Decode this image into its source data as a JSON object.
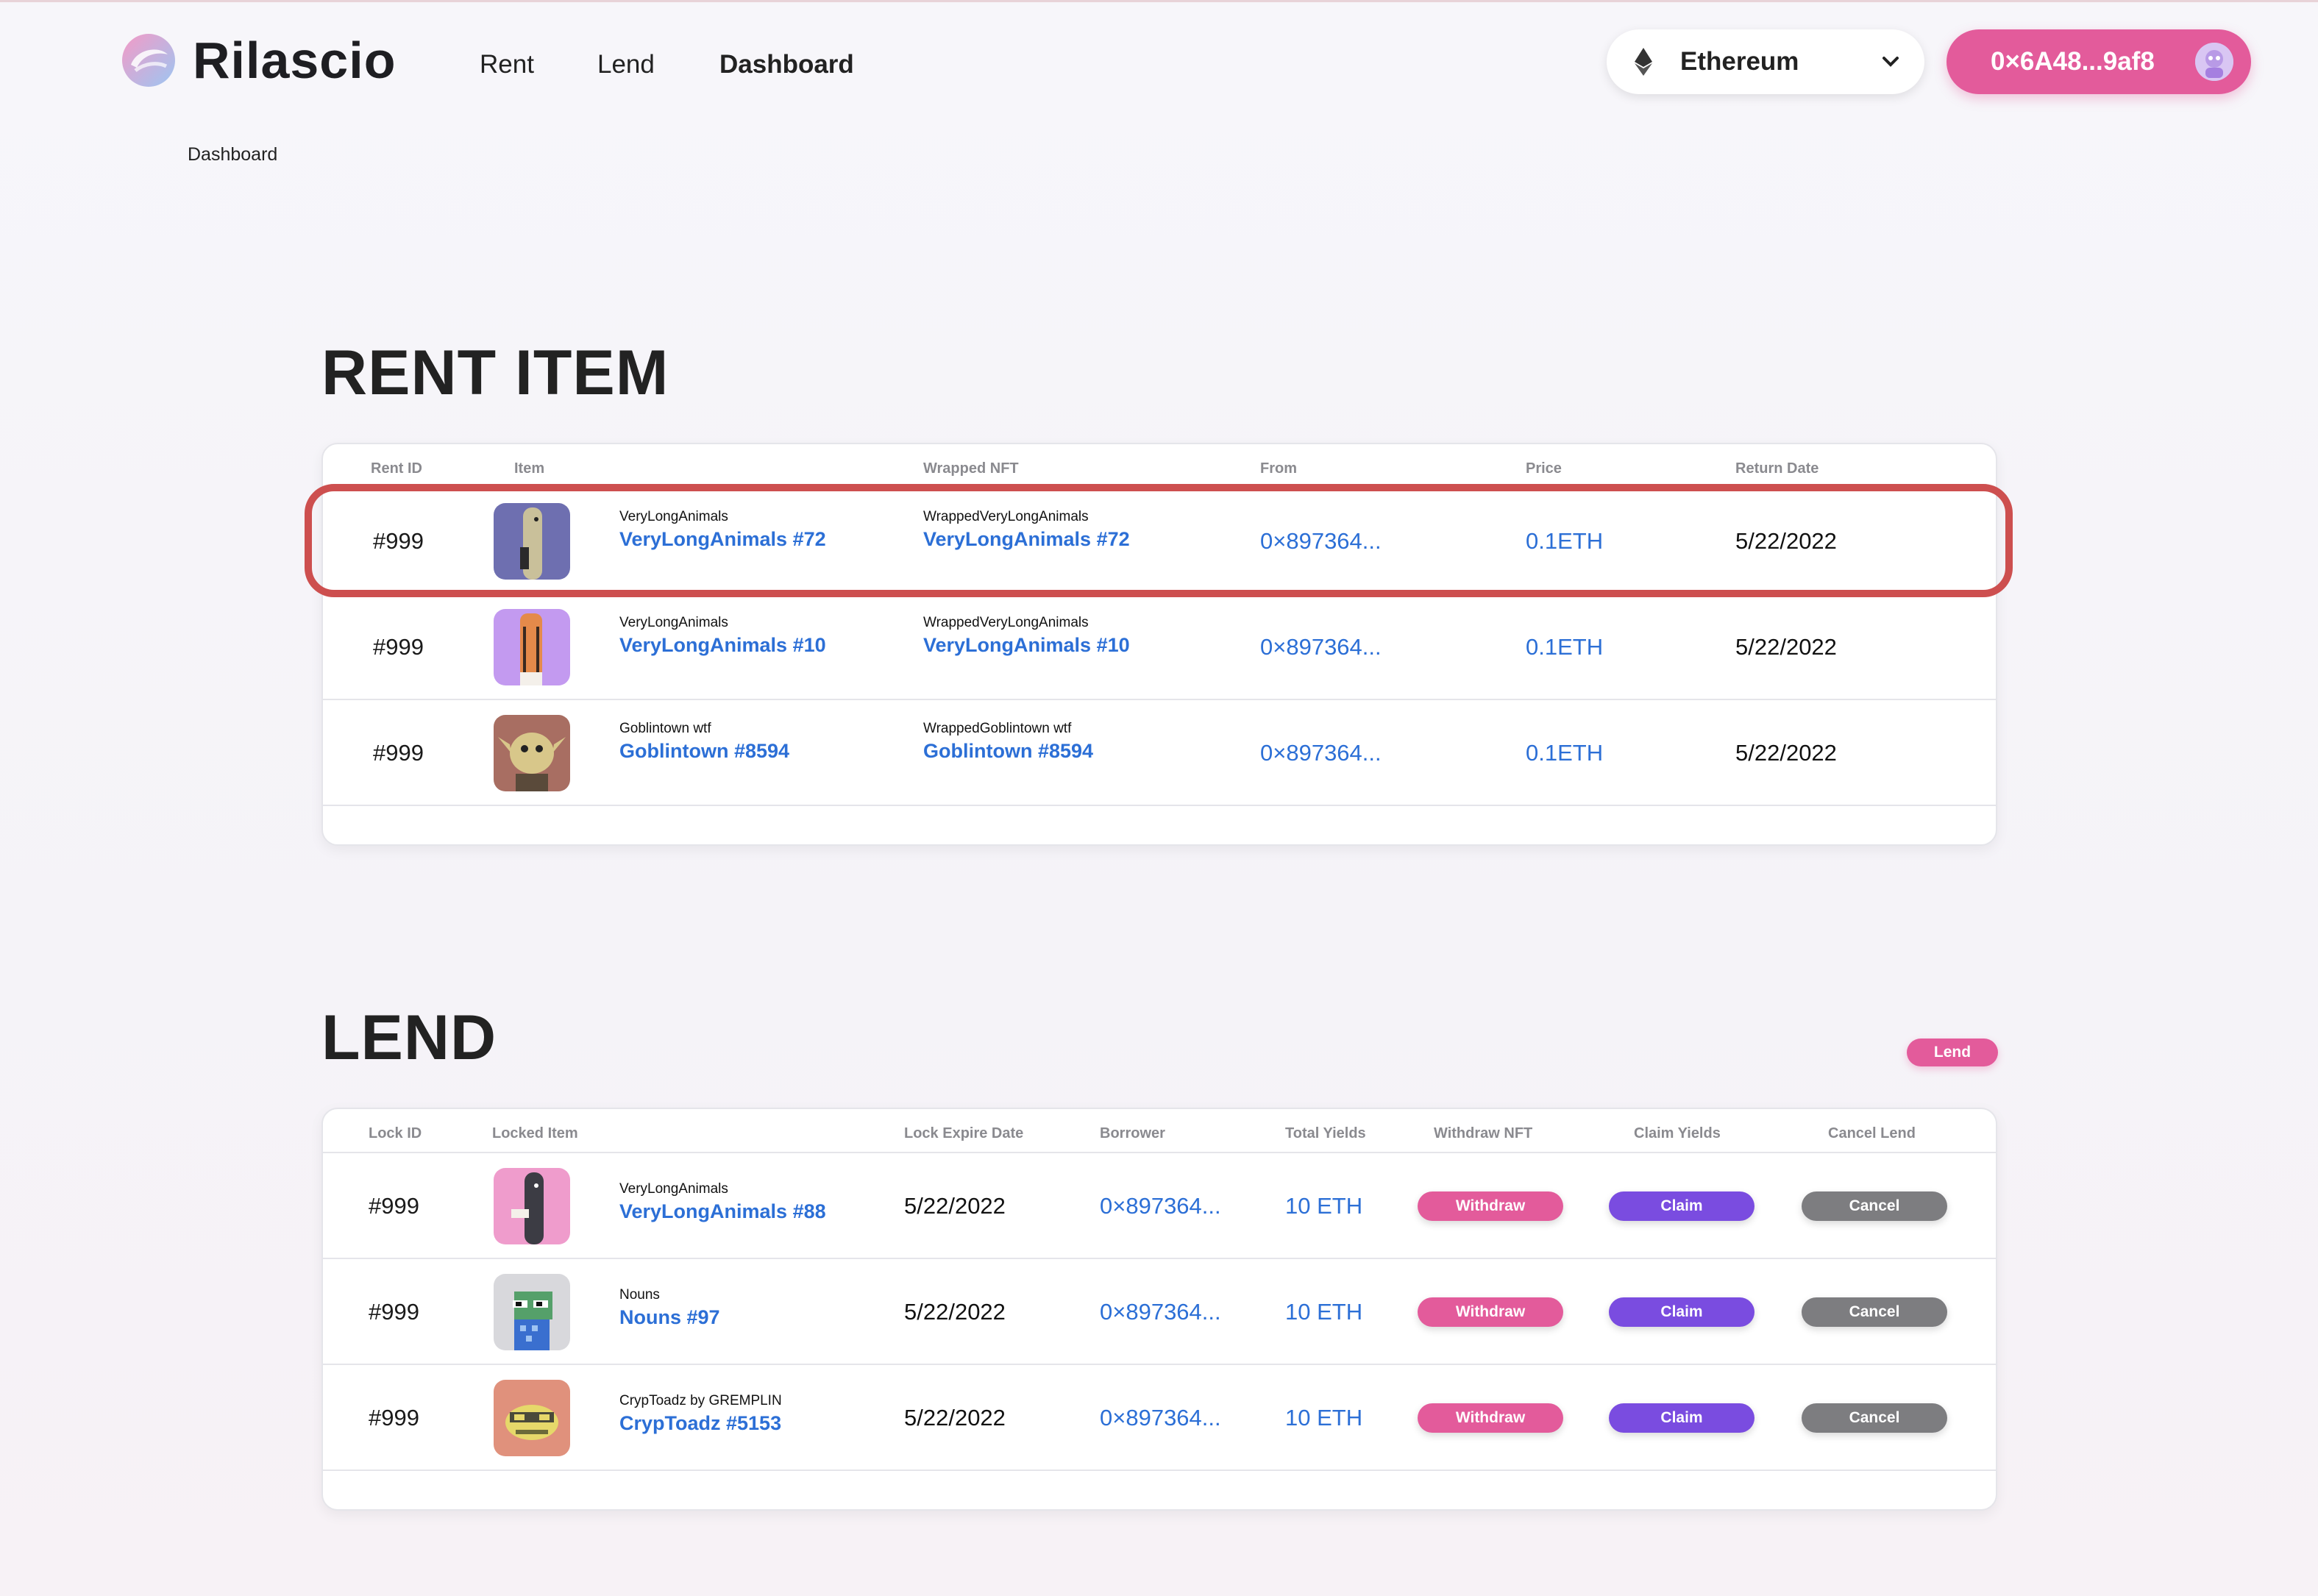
{
  "app": {
    "name": "Rilascio",
    "nav": [
      "Rent",
      "Lend",
      "Dashboard"
    ],
    "active_nav": "Dashboard",
    "chain": "Ethereum",
    "wallet": "0×6A48...9af8"
  },
  "breadcrumb": "Dashboard",
  "rent": {
    "title": "RENT ITEM",
    "columns": [
      "Rent ID",
      "Item",
      "Wrapped NFT",
      "From",
      "Price",
      "Return Date"
    ],
    "rows": [
      {
        "id": "#999",
        "collection": "VeryLongAnimals",
        "name": "VeryLongAnimals #72",
        "wrapped_collection": "WrappedVeryLongAnimals",
        "wrapped_name": "VeryLongAnimals #72",
        "from": "0×897364...",
        "price": "0.1ETH",
        "return_date": "5/22/2022",
        "thumb_color": "#6e6fb0",
        "highlighted": true
      },
      {
        "id": "#999",
        "collection": "VeryLongAnimals",
        "name": "VeryLongAnimals #10",
        "wrapped_collection": "WrappedVeryLongAnimals",
        "wrapped_name": "VeryLongAnimals #10",
        "from": "0×897364...",
        "price": "0.1ETH",
        "return_date": "5/22/2022",
        "thumb_color": "#c39af0",
        "highlighted": false
      },
      {
        "id": "#999",
        "collection": "Goblintown wtf",
        "name": "Goblintown #8594",
        "wrapped_collection": "WrappedGoblintown wtf",
        "wrapped_name": "Goblintown #8594",
        "from": "0×897364...",
        "price": "0.1ETH",
        "return_date": "5/22/2022",
        "thumb_color": "#a86e62",
        "highlighted": false
      }
    ]
  },
  "lend": {
    "title": "LEND",
    "action_button": "Lend",
    "columns": [
      "Lock ID",
      "Locked Item",
      "Lock Expire Date",
      "Borrower",
      "Total Yields",
      "Withdraw NFT",
      "Claim Yields",
      "Cancel Lend"
    ],
    "rows": [
      {
        "id": "#999",
        "collection": "VeryLongAnimals",
        "name": "VeryLongAnimals #88",
        "expire": "5/22/2022",
        "borrower": "0×897364...",
        "yields": "10 ETH",
        "withdraw": "Withdraw",
        "claim": "Claim",
        "cancel": "Cancel",
        "thumb_color": "#ef9ccc"
      },
      {
        "id": "#999",
        "collection": "Nouns",
        "name": "Nouns #97",
        "expire": "5/22/2022",
        "borrower": "0×897364...",
        "yields": "10 ETH",
        "withdraw": "Withdraw",
        "claim": "Claim",
        "cancel": "Cancel",
        "thumb_color": "#d8d8dc"
      },
      {
        "id": "#999",
        "collection": "CrypToadz by GREMPLIN",
        "name": "CrypToadz #5153",
        "expire": "5/22/2022",
        "borrower": "0×897364...",
        "yields": "10 ETH",
        "withdraw": "Withdraw",
        "claim": "Claim",
        "cancel": "Cancel",
        "thumb_color": "#e0917c"
      }
    ]
  },
  "colors": {
    "accent_pink": "#e35b9b",
    "accent_purple": "#7a4ce0",
    "link_blue": "#2c6fd6",
    "highlight_red": "#cd4f4f",
    "cancel_gray": "#7d7d80"
  }
}
